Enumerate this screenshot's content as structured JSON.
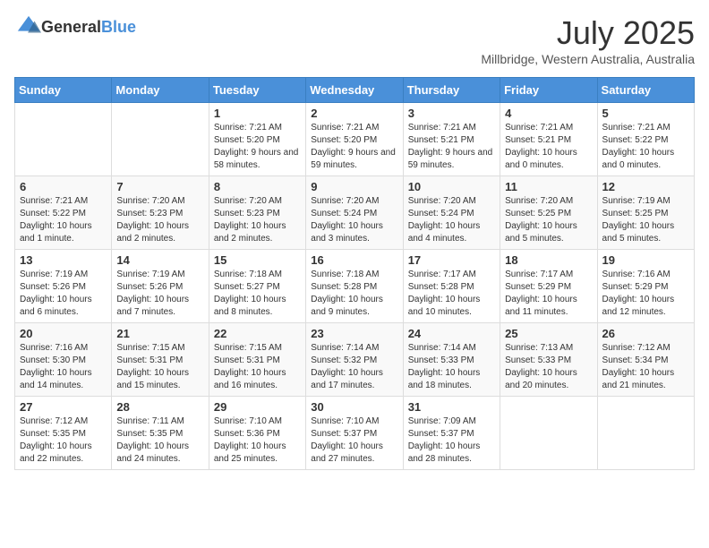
{
  "header": {
    "logo": {
      "general": "General",
      "blue": "Blue"
    },
    "title": "July 2025",
    "location": "Millbridge, Western Australia, Australia"
  },
  "calendar": {
    "headers": [
      "Sunday",
      "Monday",
      "Tuesday",
      "Wednesday",
      "Thursday",
      "Friday",
      "Saturday"
    ],
    "weeks": [
      [
        {
          "day": "",
          "content": ""
        },
        {
          "day": "",
          "content": ""
        },
        {
          "day": "1",
          "content": "Sunrise: 7:21 AM\nSunset: 5:20 PM\nDaylight: 9 hours and 58 minutes."
        },
        {
          "day": "2",
          "content": "Sunrise: 7:21 AM\nSunset: 5:20 PM\nDaylight: 9 hours and 59 minutes."
        },
        {
          "day": "3",
          "content": "Sunrise: 7:21 AM\nSunset: 5:21 PM\nDaylight: 9 hours and 59 minutes."
        },
        {
          "day": "4",
          "content": "Sunrise: 7:21 AM\nSunset: 5:21 PM\nDaylight: 10 hours and 0 minutes."
        },
        {
          "day": "5",
          "content": "Sunrise: 7:21 AM\nSunset: 5:22 PM\nDaylight: 10 hours and 0 minutes."
        }
      ],
      [
        {
          "day": "6",
          "content": "Sunrise: 7:21 AM\nSunset: 5:22 PM\nDaylight: 10 hours and 1 minute."
        },
        {
          "day": "7",
          "content": "Sunrise: 7:20 AM\nSunset: 5:23 PM\nDaylight: 10 hours and 2 minutes."
        },
        {
          "day": "8",
          "content": "Sunrise: 7:20 AM\nSunset: 5:23 PM\nDaylight: 10 hours and 2 minutes."
        },
        {
          "day": "9",
          "content": "Sunrise: 7:20 AM\nSunset: 5:24 PM\nDaylight: 10 hours and 3 minutes."
        },
        {
          "day": "10",
          "content": "Sunrise: 7:20 AM\nSunset: 5:24 PM\nDaylight: 10 hours and 4 minutes."
        },
        {
          "day": "11",
          "content": "Sunrise: 7:20 AM\nSunset: 5:25 PM\nDaylight: 10 hours and 5 minutes."
        },
        {
          "day": "12",
          "content": "Sunrise: 7:19 AM\nSunset: 5:25 PM\nDaylight: 10 hours and 5 minutes."
        }
      ],
      [
        {
          "day": "13",
          "content": "Sunrise: 7:19 AM\nSunset: 5:26 PM\nDaylight: 10 hours and 6 minutes."
        },
        {
          "day": "14",
          "content": "Sunrise: 7:19 AM\nSunset: 5:26 PM\nDaylight: 10 hours and 7 minutes."
        },
        {
          "day": "15",
          "content": "Sunrise: 7:18 AM\nSunset: 5:27 PM\nDaylight: 10 hours and 8 minutes."
        },
        {
          "day": "16",
          "content": "Sunrise: 7:18 AM\nSunset: 5:28 PM\nDaylight: 10 hours and 9 minutes."
        },
        {
          "day": "17",
          "content": "Sunrise: 7:17 AM\nSunset: 5:28 PM\nDaylight: 10 hours and 10 minutes."
        },
        {
          "day": "18",
          "content": "Sunrise: 7:17 AM\nSunset: 5:29 PM\nDaylight: 10 hours and 11 minutes."
        },
        {
          "day": "19",
          "content": "Sunrise: 7:16 AM\nSunset: 5:29 PM\nDaylight: 10 hours and 12 minutes."
        }
      ],
      [
        {
          "day": "20",
          "content": "Sunrise: 7:16 AM\nSunset: 5:30 PM\nDaylight: 10 hours and 14 minutes."
        },
        {
          "day": "21",
          "content": "Sunrise: 7:15 AM\nSunset: 5:31 PM\nDaylight: 10 hours and 15 minutes."
        },
        {
          "day": "22",
          "content": "Sunrise: 7:15 AM\nSunset: 5:31 PM\nDaylight: 10 hours and 16 minutes."
        },
        {
          "day": "23",
          "content": "Sunrise: 7:14 AM\nSunset: 5:32 PM\nDaylight: 10 hours and 17 minutes."
        },
        {
          "day": "24",
          "content": "Sunrise: 7:14 AM\nSunset: 5:33 PM\nDaylight: 10 hours and 18 minutes."
        },
        {
          "day": "25",
          "content": "Sunrise: 7:13 AM\nSunset: 5:33 PM\nDaylight: 10 hours and 20 minutes."
        },
        {
          "day": "26",
          "content": "Sunrise: 7:12 AM\nSunset: 5:34 PM\nDaylight: 10 hours and 21 minutes."
        }
      ],
      [
        {
          "day": "27",
          "content": "Sunrise: 7:12 AM\nSunset: 5:35 PM\nDaylight: 10 hours and 22 minutes."
        },
        {
          "day": "28",
          "content": "Sunrise: 7:11 AM\nSunset: 5:35 PM\nDaylight: 10 hours and 24 minutes."
        },
        {
          "day": "29",
          "content": "Sunrise: 7:10 AM\nSunset: 5:36 PM\nDaylight: 10 hours and 25 minutes."
        },
        {
          "day": "30",
          "content": "Sunrise: 7:10 AM\nSunset: 5:37 PM\nDaylight: 10 hours and 27 minutes."
        },
        {
          "day": "31",
          "content": "Sunrise: 7:09 AM\nSunset: 5:37 PM\nDaylight: 10 hours and 28 minutes."
        },
        {
          "day": "",
          "content": ""
        },
        {
          "day": "",
          "content": ""
        }
      ]
    ]
  }
}
